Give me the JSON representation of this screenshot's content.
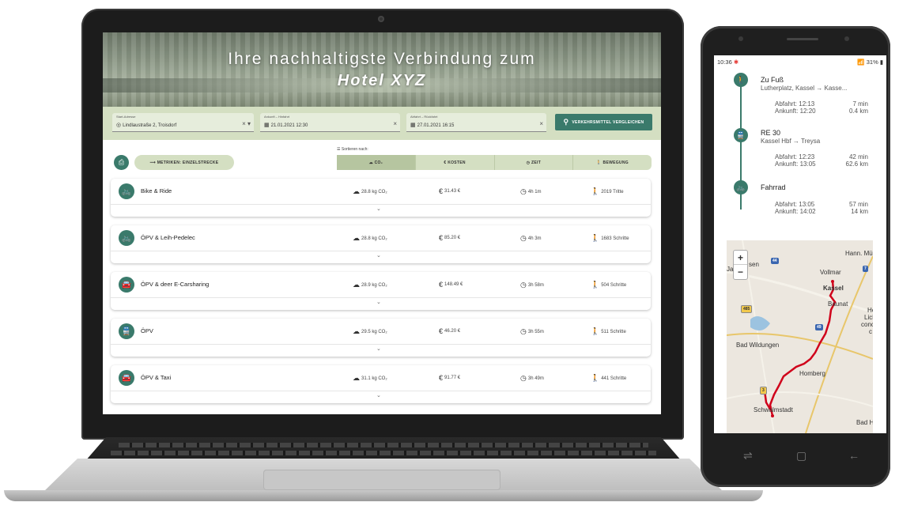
{
  "hero": {
    "title": "Ihre nachhaltigste Verbindung zum",
    "subtitle": "Hotel XYZ"
  },
  "search": {
    "start": {
      "label": "Start-Adresse",
      "value": "Lindlaustraße 2, Troisdorf",
      "icon": "target-icon"
    },
    "arrival": {
      "label": "Ankunft – Hinfahrt",
      "value": "21.01.2021 12:30",
      "icon": "calendar-icon"
    },
    "departure": {
      "label": "Abfahrt – Rückfahrt",
      "value": "27.01.2021 16:15",
      "icon": "calendar-icon"
    },
    "compare_button": "VERKEHRSMITTEL VERGLEICHEN"
  },
  "toolbar": {
    "sort_label": "Sortieren nach:",
    "metric_button": "METRIKEN: EINZELSTRECKE",
    "sort_tabs": [
      "CO₂",
      "KOSTEN",
      "ZEIT",
      "BEWEGUNG"
    ],
    "active_tab": "CO₂"
  },
  "results": [
    {
      "name": "Bike & Ride",
      "co2": "28.8 kg CO₂",
      "cost": "31.43 €",
      "time": "4h 1m",
      "move": "2019 Tritte",
      "icon": "bike-icon"
    },
    {
      "name": "ÖPV & Leih-Pedelec",
      "co2": "28.8 kg CO₂",
      "cost": "85.20 €",
      "time": "4h 3m",
      "move": "1683 Schritte",
      "icon": "bike-icon"
    },
    {
      "name": "ÖPV & deer E-Carsharing",
      "co2": "28.9 kg CO₂",
      "cost": "148.49 €",
      "time": "3h 58m",
      "move": "504 Schritte",
      "icon": "car-icon"
    },
    {
      "name": "ÖPV",
      "co2": "29.5 kg CO₂",
      "cost": "46.20 €",
      "time": "3h 55m",
      "move": "511 Schritte",
      "icon": "train-icon"
    },
    {
      "name": "ÖPV & Taxi",
      "co2": "31.1 kg CO₂",
      "cost": "91.77 €",
      "time": "3h 49m",
      "move": "441 Schritte",
      "icon": "car-icon"
    }
  ],
  "phone": {
    "status_time": "10:36",
    "status_right": "31%",
    "legs": [
      {
        "title": "Zu Fuß",
        "sub": "Lutherplatz, Kassel → Kasse...",
        "dep": "Abfahrt: 12:13",
        "arr": "Ankunft: 12:20",
        "dur": "7 min",
        "dist": "0.4 km",
        "icon": "walk-icon"
      },
      {
        "title": "RE 30",
        "sub": "Kassel Hbf → Treysa",
        "dep": "Abfahrt: 12:23",
        "arr": "Ankunft: 13:05",
        "dur": "42 min",
        "dist": "62.6 km",
        "icon": "train-icon"
      },
      {
        "title": "Fahrrad",
        "sub": "",
        "dep": "Abfahrt: 13:05",
        "arr": "Ankunft: 14:02",
        "dur": "57 min",
        "dist": "14 km",
        "icon": "bike-icon"
      }
    ],
    "map": {
      "zoom_in": "+",
      "zoom_out": "−",
      "labels": [
        "Hann. Mü",
        "Vollmar",
        "Kassel",
        "Baunat",
        "He",
        "Lich",
        "conce",
        "c",
        "Bad Wildungen",
        "Homberg",
        "Schwalmstadt",
        "Bad H",
        "Ja",
        "sen"
      ],
      "shields": [
        "44",
        "7",
        "485",
        "49",
        "3"
      ]
    }
  },
  "colors": {
    "accent": "#3a7a6b",
    "panel": "#d4dfc2",
    "route": "#d0021b"
  }
}
